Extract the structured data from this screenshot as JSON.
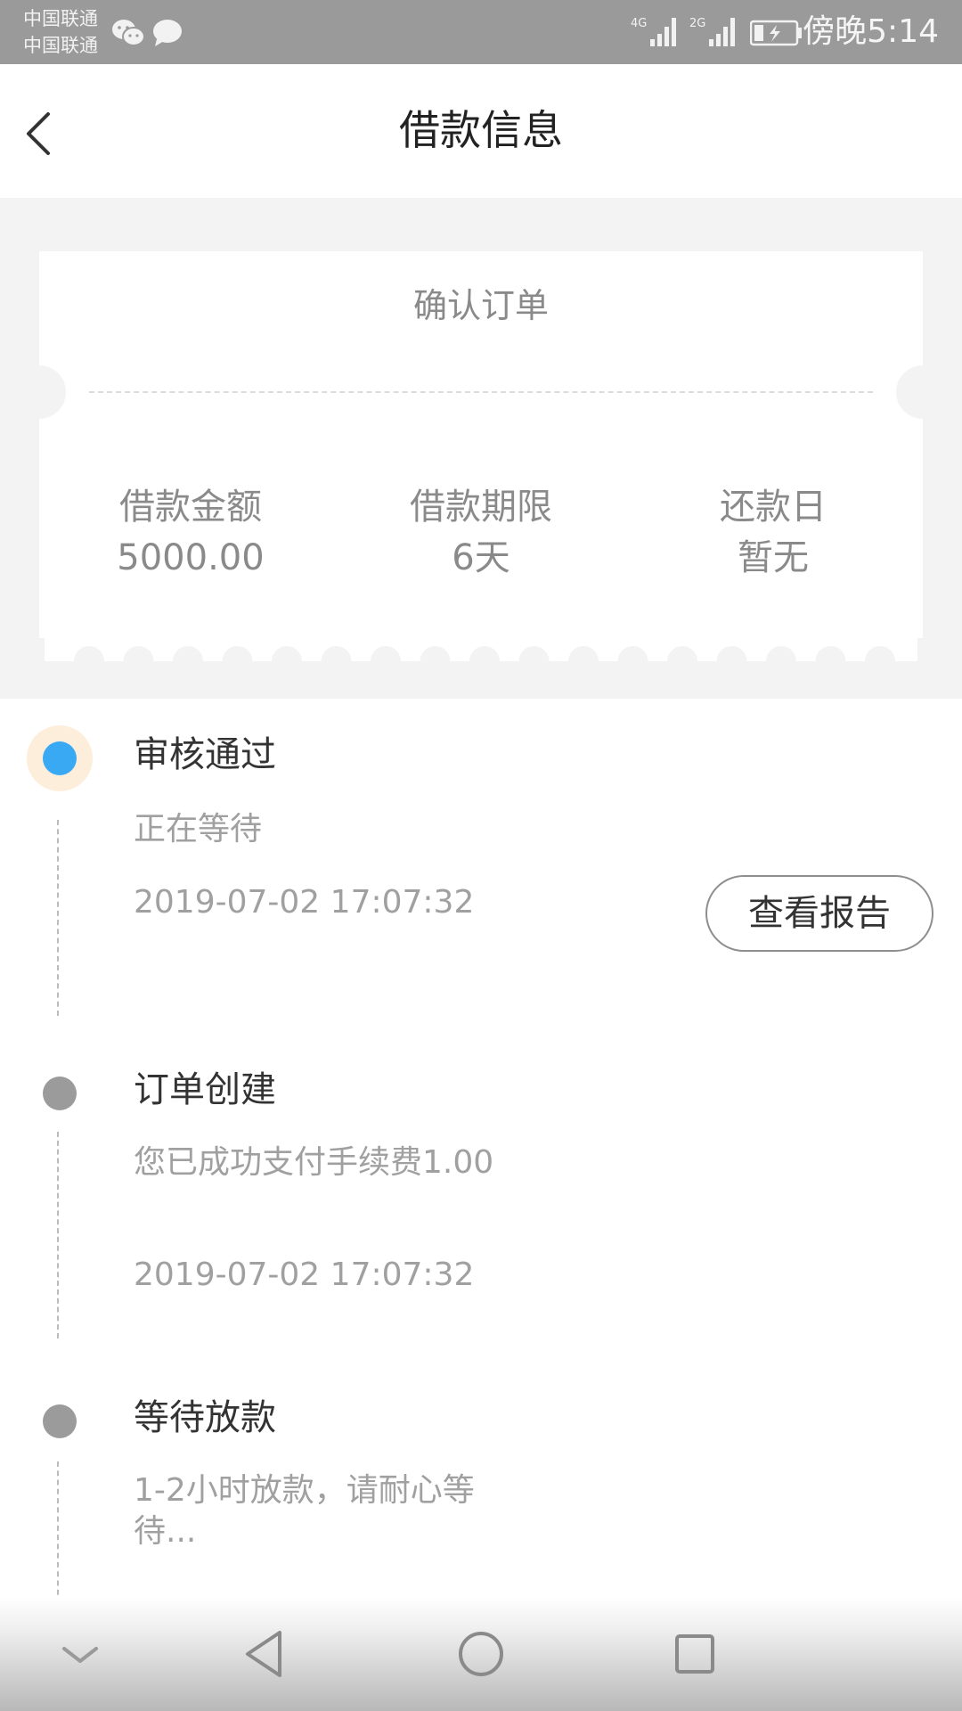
{
  "status_bar": {
    "carrier_1": "中国联通",
    "carrier_2": "中国联通",
    "signal_1_label": "4G",
    "signal_2_label": "2G",
    "time": "傍晚5:14"
  },
  "header": {
    "title": "借款信息"
  },
  "ticket": {
    "title": "确认订单",
    "columns": [
      {
        "label": "借款金额",
        "value": "5000.00"
      },
      {
        "label": "借款期限",
        "value": "6天"
      },
      {
        "label": "还款日",
        "value": "暂无"
      }
    ]
  },
  "timeline": {
    "steps": [
      {
        "title": "审核通过",
        "desc": "正在等待",
        "time": "2019-07-02 17:07:32",
        "action_label": "查看报告",
        "status": "active"
      },
      {
        "title": "订单创建",
        "desc": "您已成功支付手续费1.00",
        "time": "2019-07-02 17:07:32",
        "status": "inactive"
      },
      {
        "title": "等待放款",
        "desc": "1-2小时放款，请耐心等待...",
        "status": "inactive"
      }
    ]
  },
  "icons": {
    "back": "chevron-left-icon",
    "nav_hide": "chevron-down-icon",
    "nav_back": "triangle-back-icon",
    "nav_home": "circle-home-icon",
    "nav_recent": "square-recent-icon"
  },
  "colors": {
    "status_bar": "#9a9a9a",
    "active_dot": "#3aa9f4",
    "active_halo": "#fdeedc",
    "inactive_dot": "#9b9b9b",
    "background_gray": "#f3f3f3"
  }
}
